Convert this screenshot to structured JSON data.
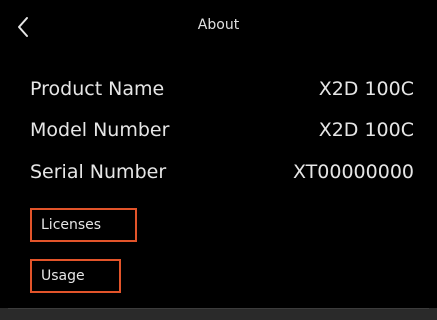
{
  "header": {
    "back_icon": "chevron-left-icon",
    "title": "About"
  },
  "info": [
    {
      "label": "Product Name",
      "value": "X2D 100C"
    },
    {
      "label": "Model Number",
      "value": "X2D 100C"
    },
    {
      "label": "Serial Number",
      "value": "XT00000000"
    }
  ],
  "buttons": {
    "licenses_label": "Licenses",
    "usage_label": "Usage"
  },
  "colors": {
    "background": "#000000",
    "text": "#e6e6e6",
    "accent": "#e2542a"
  }
}
